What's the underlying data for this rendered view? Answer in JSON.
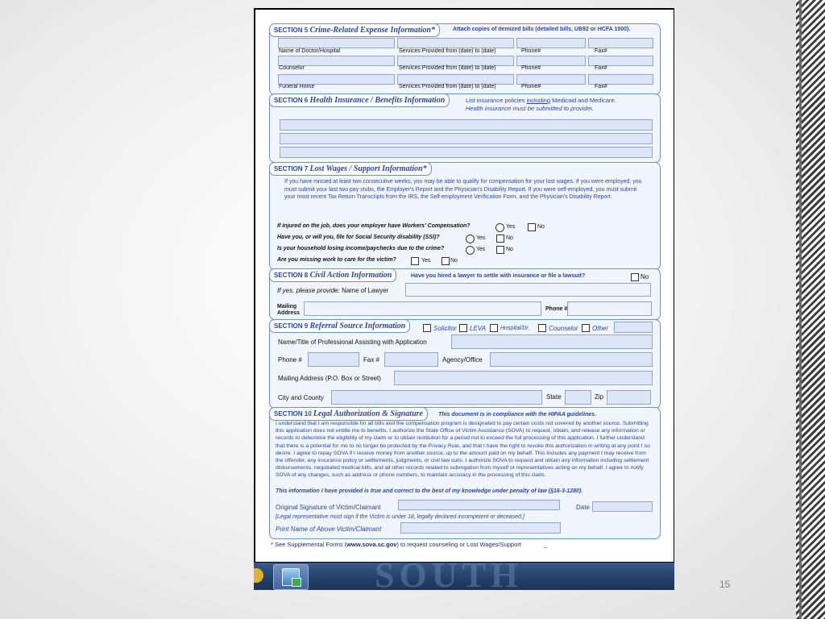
{
  "slide": {
    "page_number": "15"
  },
  "form": {
    "s5": {
      "title_num": "SECTION 5",
      "title": "Crime-Related Expense Information*",
      "note": "Attach copies of itemized bills (detailed bills, UB92 or HCFA 1500).",
      "rows": [
        {
          "name": "Name of Doctor/Hospital",
          "services": "Services Provided from (date) to (date)",
          "phone": "Phone#",
          "fax": "Fax#"
        },
        {
          "name": "Counselor",
          "services": "Services Provided from (date) to (date)",
          "phone": "Phone#",
          "fax": "Fax#"
        },
        {
          "name": "Funeral Home",
          "services": "Services Provided from (date) to (date)",
          "phone": "Phone#",
          "fax": "Fax#"
        }
      ]
    },
    "s6": {
      "title_num": "SECTION 6",
      "title": "Health Insurance / Benefits Information",
      "note_pre": "List insurance policies ",
      "note_u": "including",
      "note_post": " Medicaid and Medicare.",
      "note2": "Health insurance must be submitted to provider."
    },
    "s7": {
      "title_num": "SECTION 7",
      "title": "Lost Wages / Support Information*",
      "para": "If you have missed at least two consecutive weeks, you may be able to qualify for compensation for your lost wages. If you were employed, you must submit your last two pay stubs, the Employer's Report and the Physician's Disability Report. If you were self-employed, you must submit your most recent Tax Return Transcripts from the IRS, the Self-employment Verification Form, and the Physician's Disability Report.",
      "q1": "If injured on the job, does your employer have Workers' Compensation?",
      "q2": "Have you, or will you, file for Social Security disability (SSI)?",
      "q3": "Is your household losing income/paychecks due to the crime?",
      "q4": "Are you missing work to care for the victim?",
      "yes": "Yes",
      "no": "No"
    },
    "s8": {
      "title_num": "SECTION 8",
      "title": "Civil Action Information",
      "question": "Have you hired a lawyer to settle with insurance or file a lawsuit?",
      "no": "No",
      "ifyes": "If yes, please provide:",
      "lawyer": "Name of Lawyer",
      "mailing1": "Mailing",
      "mailing2": "Address",
      "phone": "Phone #"
    },
    "s9": {
      "title_num": "SECTION 9",
      "title": "Referral Source Information",
      "solicitor": "Solicitor",
      "leva": "LEVA",
      "hospital": "Hospital/Dr.",
      "counselor": "Counselor",
      "other": "Other",
      "name_title": "Name/Title of Professional Assisting with Application",
      "phone": "Phone #",
      "fax": "Fax #",
      "agency": "Agency/Office",
      "mailing": "Mailing Address (P.O. Box or Street)",
      "city": "City and County",
      "state": "State",
      "zip": "Zip"
    },
    "s10": {
      "title_num": "SECTION 10",
      "title": "Legal Authorization & Signature",
      "hipaa": "This document is in compliance with the HIPAA guidelines.",
      "para": "I understand that I am responsible for all bills and the compensation program is designated to pay certain costs not covered by another source. Submitting this application does not entitle me to benefits. I authorize the State Office of Victim Assistance (SOVA) to request, obtain, and release any information or records to determine the eligibility of my claim or to obtain restitution for a period not to exceed the full processing of this application. I further understand that there is a potential for me to no longer be protected by the Privacy Rule, and that I have the right to revoke this authorization in writing at any point I so desire. I agree to repay SOVA if I receive money from another source, up to the amount paid on my behalf. This includes any payment I may receive from the offender, any insurance policy or settlements, judgments, or civil law suits. I authorize SOVA to request and obtain any information including settlement disbursements, negotiated medical bills, and all other records related to subrogation from myself or representatives acting on my behalf. I agree to notify SOVA of any changes, such as address or phone numbers, to maintain accuracy in the processing of this claim.",
      "true_stmt": "This information I have provided is true and correct to the best of my knowledge under penalty of law (§16-3-1280).",
      "signature": "Original Signature of Victim/Claimant",
      "date": "Date",
      "legal_rep": "[Legal representative must sign if the Victim is under 18, legally declared incompetent or deceased.]",
      "print_name": "Print Name of Above Victim/Claimant"
    },
    "footer": {
      "pre": "* See Supplemental Forms (",
      "url": "www.sova.sc.gov",
      "post": ") to request counseling or Lost Wages/Support",
      "tail": "_"
    }
  }
}
